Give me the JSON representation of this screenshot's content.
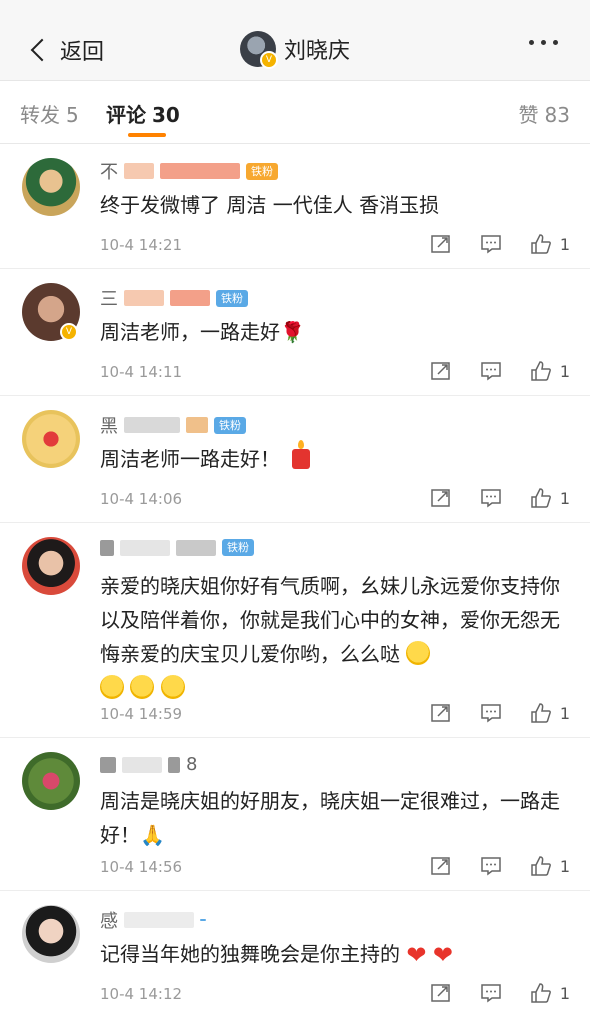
{
  "nav": {
    "back_label": "返回",
    "title": "刘晓庆"
  },
  "tabs": {
    "repost_label": "转发",
    "repost_count": "5",
    "comments_label": "评论",
    "comments_count": "30",
    "likes_label": "赞",
    "likes_count": "83"
  },
  "badge_text": "铁粉",
  "comments": [
    {
      "name": "不",
      "text": "终于发微博了   周洁 一代佳人  香消玉损",
      "time": "10-4 14:21",
      "likes": "1"
    },
    {
      "name": "三",
      "text": "周洁老师，一路走好🌹",
      "time": "10-4 14:11",
      "likes": "1"
    },
    {
      "name": "黑",
      "text": "周洁老师一路走好！",
      "time": "10-4 14:06",
      "likes": "1"
    },
    {
      "name": "",
      "text": "亲爱的晓庆姐你好有气质啊，幺妹儿永远爱你支持你以及陪伴着你，你就是我们心中的女神，爱你无怨无悔亲爱的庆宝贝儿爱你哟，么么哒",
      "time": "10-4 14:59",
      "likes": "1"
    },
    {
      "name": "8",
      "text": "周洁是晓庆姐的好朋友，晓庆姐一定很难过，一路走好！🙏",
      "time": "10-4 14:56",
      "likes": "1"
    },
    {
      "name": "感",
      "text": "记得当年她的独舞晚会是你主持的",
      "time": "10-4 14:12",
      "likes": "1"
    }
  ],
  "colors": {
    "accent": "#ff8200",
    "badge_blue": "#5aa9e6",
    "badge_gold": "#f7a830"
  }
}
